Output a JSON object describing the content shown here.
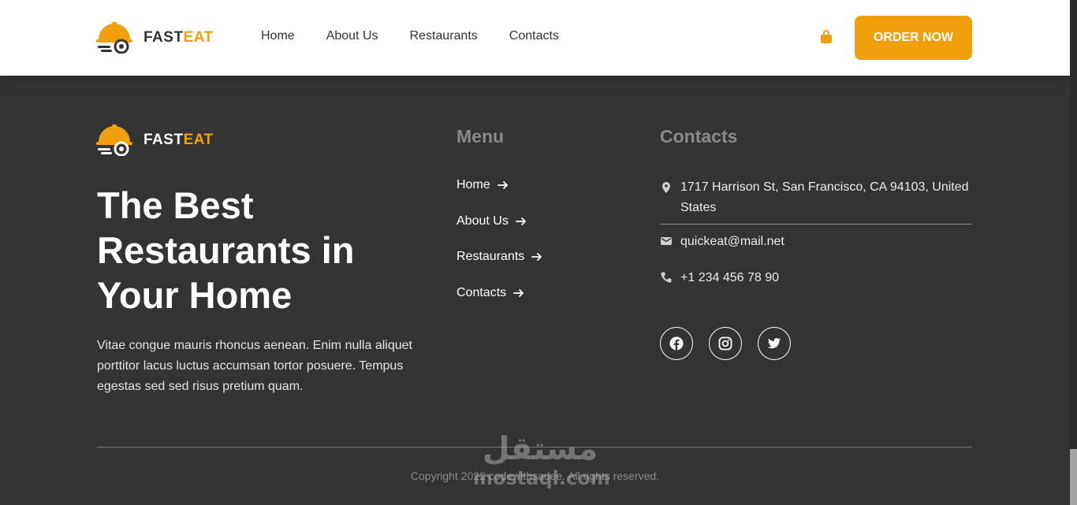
{
  "brand": {
    "name_main": "FAST",
    "name_accent": "EAT"
  },
  "header": {
    "nav": [
      "Home",
      "About Us",
      "Restaurants",
      "Contacts"
    ],
    "cart_icon": "shopping-bag-icon",
    "order_button": "ORDER NOW"
  },
  "footer": {
    "hero_title": "The Best Restaurants in Your Home",
    "hero_description": "Vitae congue mauris rhoncus aenean. Enim nulla aliquet porttitor lacus luctus accumsan tortor posuere. Tempus egestas sed sed risus pretium quam.",
    "menu": {
      "title": "Menu",
      "items": [
        "Home",
        "About Us",
        "Restaurants",
        "Contacts"
      ]
    },
    "contacts": {
      "title": "Contacts",
      "address": "1717 Harrison St, San Francisco, CA 94103, United States",
      "email": "quickeat@mail.net",
      "phone": "+1 234 456 78 90"
    },
    "social": [
      "facebook-icon",
      "instagram-icon",
      "twitter-icon"
    ],
    "copyright": "Copyright 2022 codewithsadee. All rights reserved."
  },
  "watermark": {
    "arabic": "مستقل",
    "latin": "mostaql.com"
  },
  "colors": {
    "accent": "#f0a00c",
    "footer_bg": "#333333",
    "header_bg": "#ffffff"
  }
}
